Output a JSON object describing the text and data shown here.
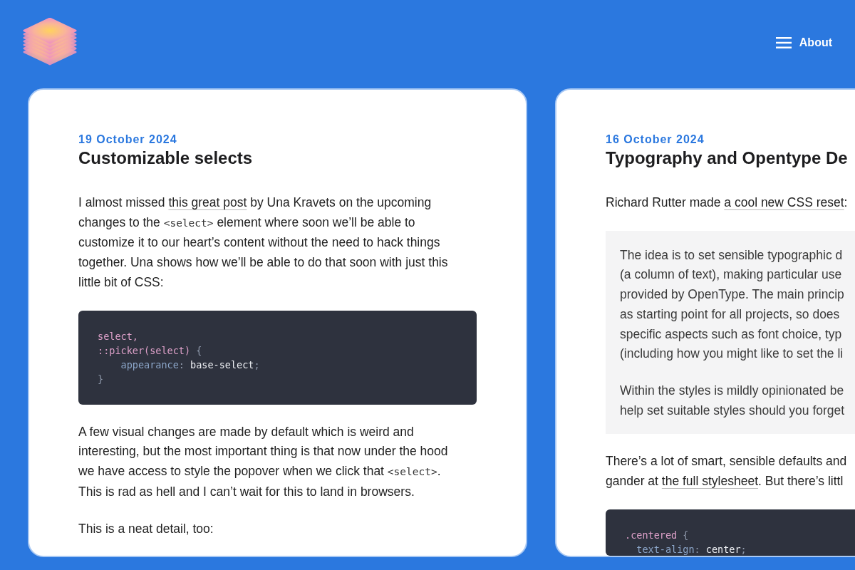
{
  "header": {
    "menu_label": "About"
  },
  "posts": [
    {
      "date": "19 October 2024",
      "title": "Customizable selects",
      "blocks": [
        {
          "kind": "paragraph",
          "lines": [
            [
              {
                "kind": "text",
                "text": "I almost missed "
              },
              {
                "kind": "link",
                "text": "this great post"
              },
              {
                "kind": "text",
                "text": " by Una Kravets on the upcoming"
              }
            ],
            [
              {
                "kind": "text",
                "text": "changes to the "
              },
              {
                "kind": "code",
                "text": "<select>"
              },
              {
                "kind": "text",
                "text": " element where soon we’ll be able to"
              }
            ],
            [
              {
                "kind": "text",
                "text": "customize it to our heart’s content without the need to hack things"
              }
            ],
            [
              {
                "kind": "text",
                "text": "together. Una shows how we’ll be able to do that soon with just this"
              }
            ],
            [
              {
                "kind": "text",
                "text": "little bit of CSS:"
              }
            ]
          ]
        },
        {
          "kind": "code",
          "lines": [
            [
              {
                "kind": "selector",
                "text": "select,"
              }
            ],
            [
              {
                "kind": "selector",
                "text": "::picker(select)"
              },
              {
                "kind": "punctuation",
                "text": " {"
              }
            ],
            [
              {
                "kind": "property",
                "text": "    appearance"
              },
              {
                "kind": "punctuation",
                "text": ": "
              },
              {
                "kind": "value",
                "text": "base-select"
              },
              {
                "kind": "punctuation",
                "text": ";"
              }
            ],
            [
              {
                "kind": "punctuation",
                "text": "}"
              }
            ]
          ]
        },
        {
          "kind": "paragraph",
          "lines": [
            [
              {
                "kind": "text",
                "text": "A few visual changes are made by default which is weird and"
              }
            ],
            [
              {
                "kind": "text",
                "text": "interesting, but the most important thing is that now under the hood"
              }
            ],
            [
              {
                "kind": "text",
                "text": "we have access to style the popover when we click that "
              },
              {
                "kind": "code",
                "text": "<select>"
              },
              {
                "kind": "text",
                "text": "."
              }
            ],
            [
              {
                "kind": "text",
                "text": "This is rad as hell and I can’t wait for this to land in browsers."
              }
            ]
          ]
        },
        {
          "kind": "paragraph",
          "lines": [
            [
              {
                "kind": "text",
                "text": "This is a neat detail, too:"
              }
            ]
          ]
        }
      ]
    },
    {
      "date": "16 October 2024",
      "title": "Typography and Opentype De",
      "blocks": [
        {
          "kind": "paragraph",
          "lines": [
            [
              {
                "kind": "text",
                "text": "Richard Rutter made "
              },
              {
                "kind": "link",
                "text": "a cool new CSS reset"
              },
              {
                "kind": "text",
                "text": ":"
              }
            ]
          ]
        },
        {
          "kind": "quote",
          "paragraphs": [
            {
              "lines": [
                [
                  {
                    "kind": "text",
                    "text": "The idea is to set sensible typographic d"
                  }
                ],
                [
                  {
                    "kind": "text",
                    "text": "(a column of text), making particular use"
                  }
                ],
                [
                  {
                    "kind": "text",
                    "text": "provided by OpenType. The main princip"
                  }
                ],
                [
                  {
                    "kind": "text",
                    "text": "as starting point for all projects, so does"
                  }
                ],
                [
                  {
                    "kind": "text",
                    "text": "specific aspects such as font choice, typ"
                  }
                ],
                [
                  {
                    "kind": "text",
                    "text": "(including how you might like to set the li"
                  }
                ]
              ]
            },
            {
              "lines": [
                [
                  {
                    "kind": "text",
                    "text": "Within the styles is mildly opinionated be"
                  }
                ],
                [
                  {
                    "kind": "text",
                    "text": "help set suitable styles should you forget"
                  }
                ]
              ]
            }
          ]
        },
        {
          "kind": "paragraph",
          "lines": [
            [
              {
                "kind": "text",
                "text": "There’s a lot of smart, sensible defaults and"
              }
            ],
            [
              {
                "kind": "text",
                "text": "gander at "
              },
              {
                "kind": "link",
                "text": "the full stylesheet"
              },
              {
                "kind": "text",
                "text": ". But there’s littl"
              }
            ]
          ]
        },
        {
          "kind": "code",
          "lines": [
            [
              {
                "kind": "selector",
                "text": ".centered"
              },
              {
                "kind": "punctuation",
                "text": " {"
              }
            ],
            [
              {
                "kind": "property",
                "text": "  text-align"
              },
              {
                "kind": "punctuation",
                "text": ": "
              },
              {
                "kind": "value",
                "text": "center"
              },
              {
                "kind": "punctuation",
                "text": ";"
              }
            ]
          ]
        }
      ]
    }
  ]
}
